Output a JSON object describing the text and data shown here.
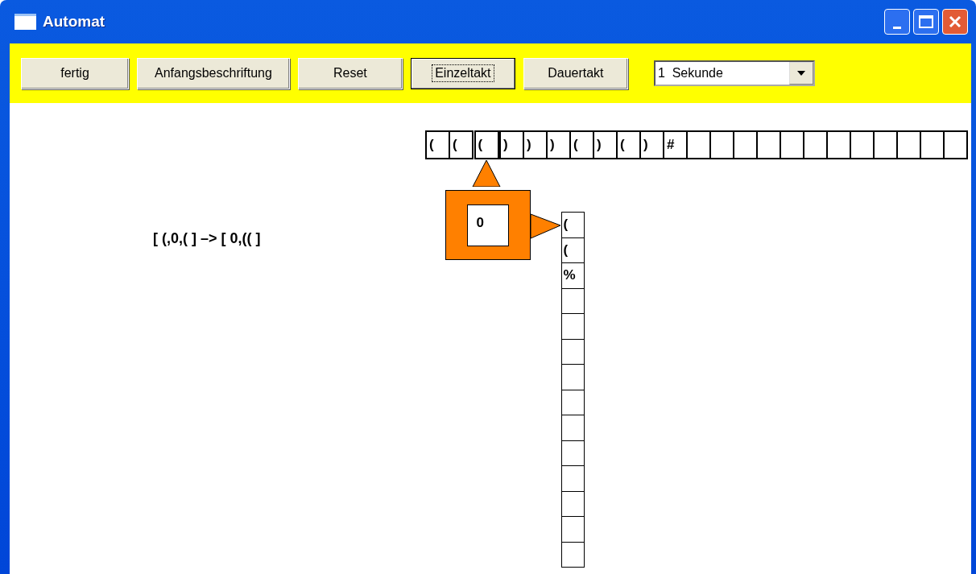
{
  "window": {
    "title": "Automat"
  },
  "toolbar": {
    "buttons": [
      {
        "label": "fertig",
        "focused": false
      },
      {
        "label": "Anfangsbeschriftung",
        "focused": false
      },
      {
        "label": "Reset",
        "focused": false
      },
      {
        "label": "Einzeltakt",
        "focused": true
      },
      {
        "label": "Dauertakt",
        "focused": false
      }
    ],
    "speed_select": {
      "value": "1  Sekunde"
    }
  },
  "rule": "[ (,0,( ] –> [ 0,(( ]",
  "tape": [
    {
      "kind": "symbol",
      "symbol": "(",
      "selected": false
    },
    {
      "kind": "symbol",
      "symbol": "(",
      "selected": false
    },
    {
      "kind": "symbol",
      "symbol": "(",
      "selected": true
    },
    {
      "kind": "symbol",
      "symbol": ")",
      "selected": false
    },
    {
      "kind": "symbol",
      "symbol": ")",
      "selected": false
    },
    {
      "kind": "symbol",
      "symbol": ")",
      "selected": false
    },
    {
      "kind": "symbol",
      "symbol": "(",
      "selected": false
    },
    {
      "kind": "symbol",
      "symbol": ")",
      "selected": false
    },
    {
      "kind": "symbol",
      "symbol": "(",
      "selected": false
    },
    {
      "kind": "symbol",
      "symbol": ")",
      "selected": false
    },
    {
      "kind": "symbol",
      "symbol": "#",
      "selected": false
    },
    {
      "kind": "blank",
      "selected": false
    },
    {
      "kind": "blank",
      "selected": false
    },
    {
      "kind": "blank",
      "selected": false
    },
    {
      "kind": "blank",
      "selected": false
    },
    {
      "kind": "blank",
      "selected": false
    },
    {
      "kind": "blank",
      "selected": false
    },
    {
      "kind": "blank",
      "selected": false
    },
    {
      "kind": "blank",
      "selected": false
    },
    {
      "kind": "blank",
      "selected": false
    },
    {
      "kind": "blank",
      "selected": false
    },
    {
      "kind": "blank",
      "selected": false
    },
    {
      "kind": "blank",
      "selected": false
    }
  ],
  "head": {
    "state": "0"
  },
  "stack": [
    {
      "kind": "symbol",
      "symbol": "("
    },
    {
      "kind": "symbol",
      "symbol": "("
    },
    {
      "kind": "symbol",
      "symbol": "%"
    },
    {
      "kind": "blank"
    },
    {
      "kind": "blank"
    },
    {
      "kind": "blank"
    },
    {
      "kind": "blank"
    },
    {
      "kind": "blank"
    },
    {
      "kind": "blank"
    },
    {
      "kind": "blank"
    },
    {
      "kind": "blank"
    },
    {
      "kind": "blank"
    },
    {
      "kind": "blank"
    },
    {
      "kind": "blank"
    }
  ]
}
